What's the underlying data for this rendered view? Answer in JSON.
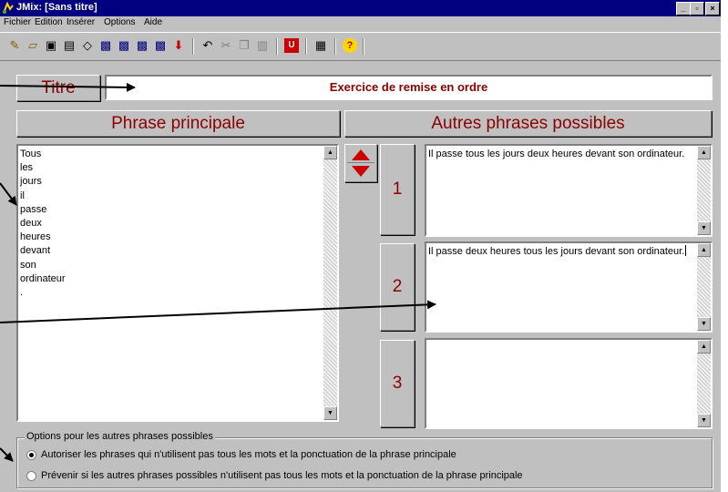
{
  "window": {
    "title": "JMix: [Sans titre]"
  },
  "caption_buttons": [
    "_",
    "▫",
    "×"
  ],
  "menu": [
    {
      "id": "fichier",
      "label": "Fichier"
    },
    {
      "id": "edition",
      "label": "Edition"
    },
    {
      "id": "inserer",
      "label": "Insérer"
    },
    {
      "id": "options",
      "label": "Options"
    },
    {
      "id": "aide",
      "label": "Aide"
    }
  ],
  "title_section": {
    "label": "Titre",
    "value": "Exercice de remise en ordre"
  },
  "main_sentence": {
    "header": "Phrase principale",
    "words": "Tous\nles\njours\nil\npasse\ndeux\nheures\ndevant\nson\nordinateur\n."
  },
  "alternatives": {
    "header": "Autres phrases possibles",
    "items": [
      {
        "number": "1",
        "text": "Il passe tous les jours deux heures devant son ordinateur."
      },
      {
        "number": "2",
        "text": "Il passe deux heures tous les jours devant son ordinateur."
      },
      {
        "number": "3",
        "text": ""
      }
    ]
  },
  "options_group": {
    "legend": "Options pour les autres phrases possibles",
    "options": [
      {
        "label": "Autoriser les phrases qui n'utilisent pas tous les mots et la ponctuation de la phrase principale",
        "selected": true
      },
      {
        "label": "Prévenir si les autres phrases possibles n'utilisent pas tous les mots et la ponctuation de la phrase principale",
        "selected": false
      }
    ]
  },
  "colors": {
    "titlebar": "#000080",
    "header_text": "#8b0000",
    "face": "#c0c0c0",
    "accent_red": "#cc0000"
  }
}
